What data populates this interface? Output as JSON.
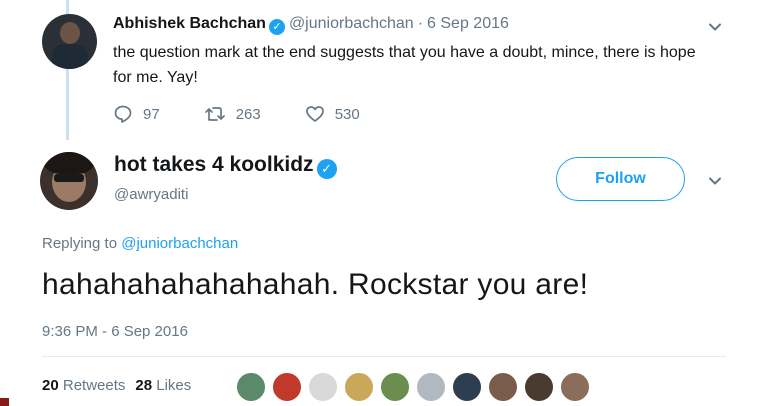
{
  "parent_tweet": {
    "name": "Abhishek Bachchan",
    "handle": "@juniorbachchan",
    "separator": "·",
    "date": "6 Sep 2016",
    "text": "the question mark at the end suggests that you have a doubt, mince, there is hope for me. Yay!",
    "replies": "97",
    "retweets": "263",
    "likes": "530"
  },
  "main_tweet": {
    "name": "hot takes 4 koolkidz",
    "handle": "@awryaditi",
    "follow_label": "Follow",
    "replying_prefix": "Replying to",
    "replying_to": "@juniorbachchan",
    "text": "hahahahahahahahah. Rockstar you are!",
    "timestamp": "9:36 PM - 6 Sep 2016",
    "retweet_count": "20",
    "retweet_label": "Retweets",
    "like_count": "28",
    "like_label": "Likes"
  },
  "likers": [
    {
      "color": "#5a8a6a"
    },
    {
      "color": "#c0392b"
    },
    {
      "color": "#d9d9d9"
    },
    {
      "color": "#c9a85a"
    },
    {
      "color": "#6b8e4e"
    },
    {
      "color": "#b0b8c0"
    },
    {
      "color": "#2c3e50"
    },
    {
      "color": "#7a5c4a"
    },
    {
      "color": "#4a3a30"
    },
    {
      "color": "#8c6d5a"
    }
  ],
  "colors": {
    "accent": "#1da1f2",
    "secondary_text": "#657786",
    "thread_line": "#c4e1f6"
  },
  "icons": {
    "verified": "verified-badge-icon",
    "reply": "reply-icon",
    "retweet": "retweet-icon",
    "like": "heart-icon",
    "menu": "chevron-down-icon"
  }
}
